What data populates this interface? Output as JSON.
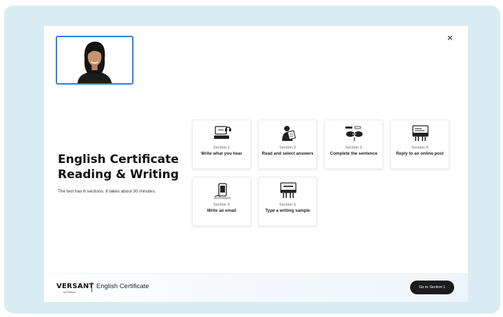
{
  "header": {
    "close_label": "×"
  },
  "intro": {
    "title_line1": "English Certificate",
    "title_line2": "Reading & Writing",
    "subtitle": "The test has 6 sections. It takes about 30 minutes."
  },
  "sections": [
    {
      "section": "Section 1",
      "name": "Write what you hear",
      "icon": "typing-headphones-icon"
    },
    {
      "section": "Section 2",
      "name": "Read and select answers",
      "icon": "reading-person-icon"
    },
    {
      "section": "Section 3",
      "name": "Complete the sentence",
      "icon": "sentence-bubbles-icon"
    },
    {
      "section": "Section 4",
      "name": "Reply to an online post",
      "icon": "online-post-icon"
    },
    {
      "section": "Section 5",
      "name": "Write an email",
      "icon": "email-device-icon"
    },
    {
      "section": "Section 6",
      "name": "Type a writing sample",
      "icon": "writing-sample-icon"
    }
  ],
  "footer": {
    "logo": "VERSANT",
    "logo_sub": "by Pearson",
    "product": "English Certificate",
    "go_button": "Go to Section 1"
  },
  "colors": {
    "frame_bg": "#d9ecf3",
    "webcam_border": "#2f7be5",
    "button_bg": "#1b1b1b"
  }
}
